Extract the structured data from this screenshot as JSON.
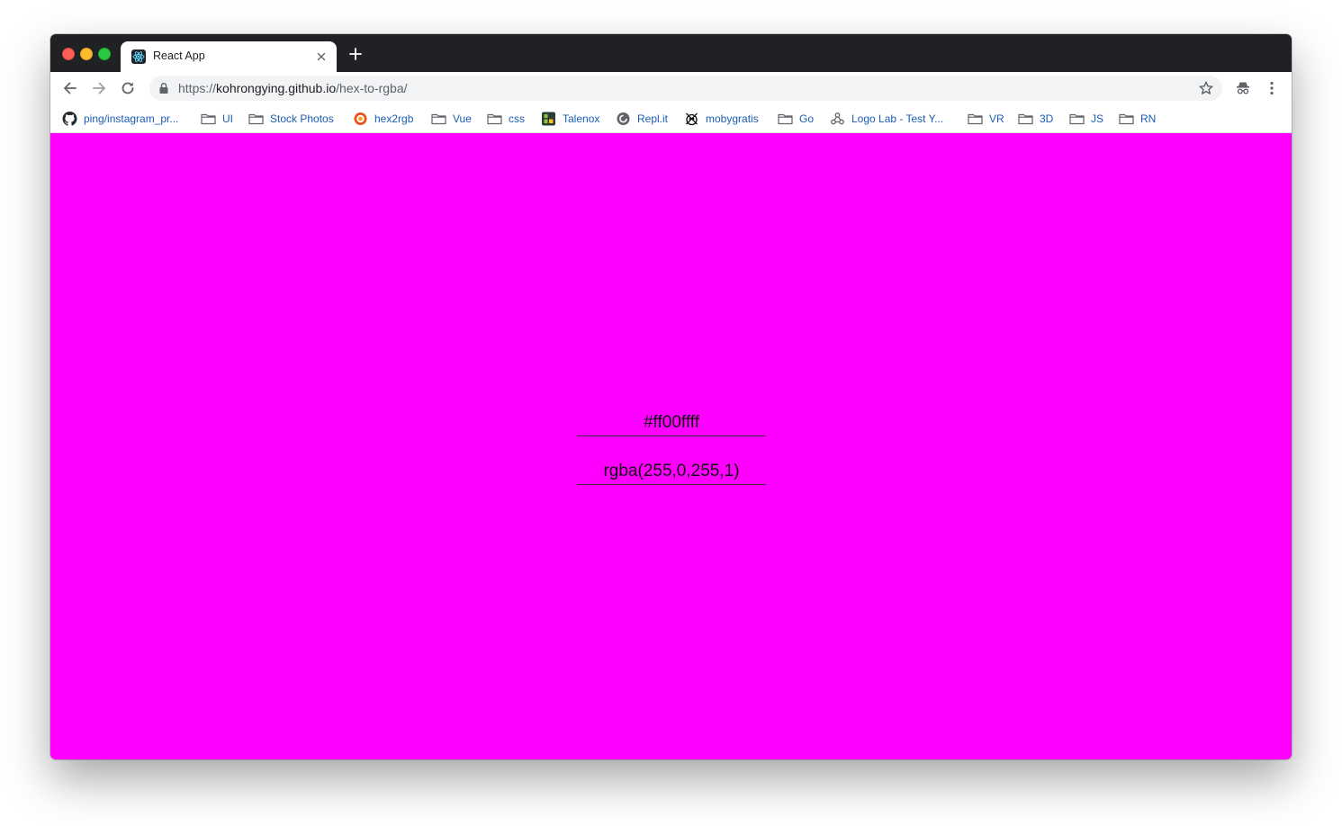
{
  "browser": {
    "tab": {
      "title": "React App"
    },
    "address_bar": {
      "scheme": "https://",
      "host": "kohrongying.github.io",
      "path": "/hex-to-rgba/"
    },
    "bookmarks": [
      {
        "label": "ping/instagram_pr...",
        "icon": "github-icon"
      },
      {
        "label": "UI",
        "icon": "folder-icon"
      },
      {
        "label": "Stock Photos",
        "icon": "folder-icon"
      },
      {
        "label": "hex2rgb",
        "icon": "globe-icon"
      },
      {
        "label": "Vue",
        "icon": "folder-icon"
      },
      {
        "label": "css",
        "icon": "folder-icon"
      },
      {
        "label": "Talenox",
        "icon": "talenox-icon"
      },
      {
        "label": "Repl.it",
        "icon": "replit-icon"
      },
      {
        "label": "mobygratis",
        "icon": "mobygratis-icon"
      },
      {
        "label": "Go",
        "icon": "folder-icon"
      },
      {
        "label": "Logo Lab - Test Y...",
        "icon": "logolab-icon"
      },
      {
        "label": "VR",
        "icon": "folder-icon"
      },
      {
        "label": "3D",
        "icon": "folder-icon"
      },
      {
        "label": "JS",
        "icon": "folder-icon"
      },
      {
        "label": "RN",
        "icon": "folder-icon"
      }
    ]
  },
  "app": {
    "background_color": "#ff00ff",
    "hex_input": {
      "value": "#ff00ffff"
    },
    "rgba_output": {
      "value": "rgba(255,0,255,1)"
    }
  }
}
